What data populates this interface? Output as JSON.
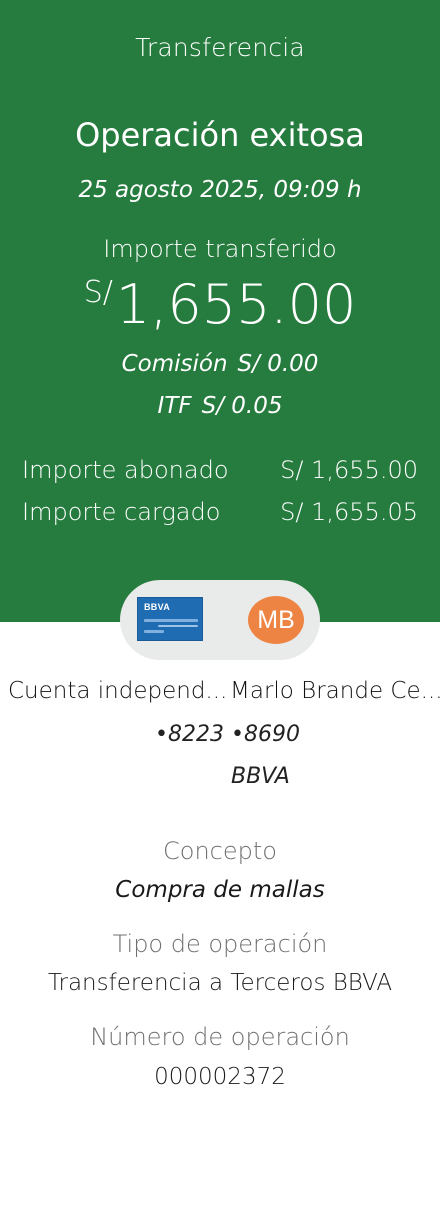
{
  "header": {
    "title": "Transferencia"
  },
  "result": {
    "status": "Operación exitosa",
    "datetime": "25 agosto 2025, 09:09 h",
    "amount_label": "Importe transferido",
    "currency": "S/",
    "amount": "1,655.00",
    "fee_label": "Comisión",
    "fee_value": "S/ 0.00",
    "itf_label": "ITF",
    "itf_value": "S/ 0.05"
  },
  "summary": {
    "credited_label": "Importe abonado",
    "credited_value": "S/ 1,655.00",
    "charged_label": "Importe cargado",
    "charged_value": "S/ 1,655.05"
  },
  "origin": {
    "card_brand": "BBVA",
    "name": "Cuenta independ...",
    "number": "•8223"
  },
  "destination": {
    "initials": "MB",
    "name": "Marlo Brande Ce...",
    "number": "•8690",
    "bank": "BBVA"
  },
  "details": {
    "concept_label": "Concepto",
    "concept_value": "Compra de mallas",
    "type_label": "Tipo de operación",
    "type_value": "Transferencia a Terceros BBVA",
    "number_label": "Número de operación",
    "number_value": "000002372"
  },
  "colors": {
    "header_green": "#267c3e",
    "avatar_orange": "#ee8443",
    "card_blue": "#1f6cb3"
  }
}
